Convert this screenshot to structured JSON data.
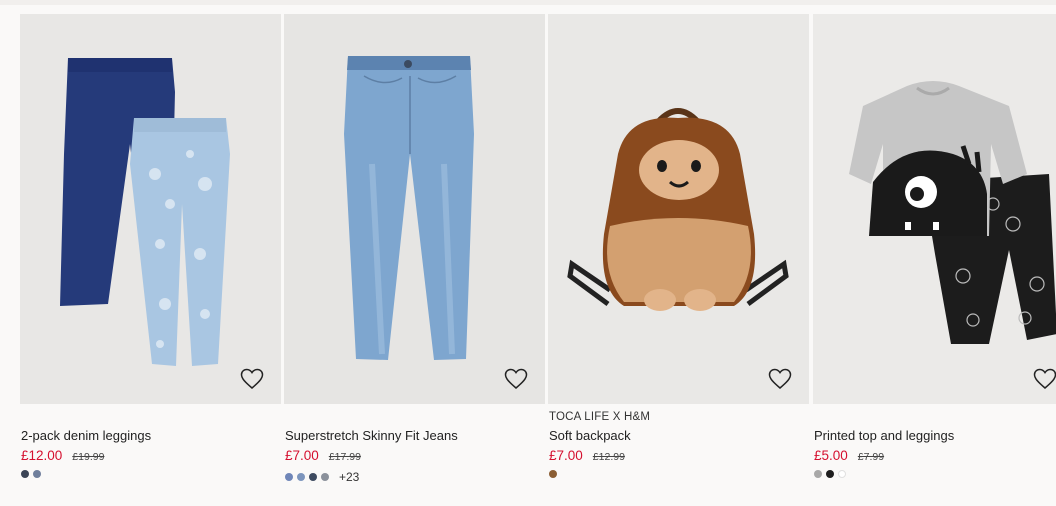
{
  "products": [
    {
      "brand": "",
      "title": "2-pack denim leggings",
      "price": "£12.00",
      "old_price": "£19.99",
      "swatches": [
        "#3a4455",
        "#6f7f9c"
      ],
      "more_colors": "",
      "image": "denim-leggings-image"
    },
    {
      "brand": "",
      "title": "Superstretch Skinny Fit Jeans",
      "price": "£7.00",
      "old_price": "£17.99",
      "swatches": [
        "#6f86b8",
        "#7c95bd",
        "#3d4a60",
        "#8b919b"
      ],
      "more_colors": "+23",
      "image": "skinny-jeans-image"
    },
    {
      "brand": "TOCA LIFE X H&M",
      "title": "Soft backpack",
      "price": "£7.00",
      "old_price": "£12.99",
      "swatches": [
        "#8b5e34"
      ],
      "more_colors": "",
      "image": "plush-backpack-image"
    },
    {
      "brand": "",
      "title": "Printed top and leggings",
      "price": "£5.00",
      "old_price": "£7.99",
      "swatches": [
        "#a8a8a8",
        "#1e1e1e",
        "#ffffff"
      ],
      "more_colors": "",
      "image": "top-and-leggings-image"
    }
  ],
  "icons": {
    "favourite": "heart-outline-icon"
  },
  "colors": {
    "sale_price": "#d5102f",
    "page_background": "#faf9f8"
  }
}
